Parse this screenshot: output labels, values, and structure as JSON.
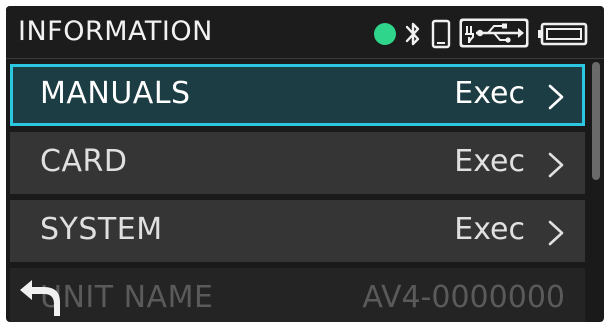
{
  "header": {
    "title": "INFORMATION",
    "status_icons": [
      "connection-status-dot",
      "bluetooth-icon",
      "phone-icon",
      "usb-power-icon",
      "battery-icon"
    ],
    "status_dot_color": "#2fd58a"
  },
  "menu": {
    "items": [
      {
        "label": "MANUALS",
        "value": "Exec",
        "selected": true
      },
      {
        "label": "CARD",
        "value": "Exec",
        "selected": false
      },
      {
        "label": "SYSTEM",
        "value": "Exec",
        "selected": false
      },
      {
        "label": "UNIT NAME",
        "value": "AV4-0000000",
        "selected": false
      }
    ]
  },
  "colors": {
    "selected_border": "#2bc6e0",
    "selected_background": "#1c3d44",
    "row_background": "#353535"
  },
  "navigation": {
    "back_icon": "back-arrow-icon"
  }
}
